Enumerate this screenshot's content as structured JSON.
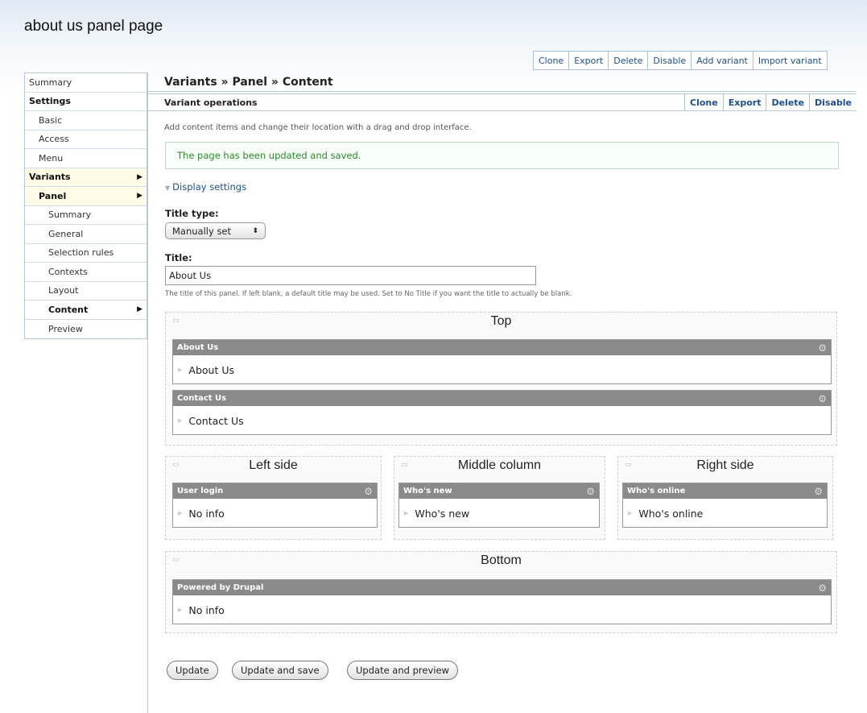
{
  "page": {
    "title": "about us panel page"
  },
  "top_actions": [
    "Clone",
    "Export",
    "Delete",
    "Disable",
    "Add variant",
    "Import variant"
  ],
  "leftnav": [
    {
      "label": "Summary"
    },
    {
      "label": "Settings"
    },
    {
      "label": "Basic"
    },
    {
      "label": "Access"
    },
    {
      "label": "Menu"
    },
    {
      "label": "Variants"
    },
    {
      "label": "Panel"
    },
    {
      "label": "Summary"
    },
    {
      "label": "General"
    },
    {
      "label": "Selection rules"
    },
    {
      "label": "Contexts"
    },
    {
      "label": "Layout"
    },
    {
      "label": "Content"
    },
    {
      "label": "Preview"
    }
  ],
  "main": {
    "breadcrumb": "Variants » Panel » Content",
    "variant_ops": {
      "label": "Variant operations",
      "actions": [
        "Clone",
        "Export",
        "Delete",
        "Disable"
      ]
    },
    "intro": "Add content items and change their location with a drag and drop interface.",
    "status": "The page has been updated and saved.",
    "display_settings": "Display settings",
    "title_type": {
      "label": "Title type:",
      "value": "Manually set"
    },
    "title_field": {
      "label": "Title:",
      "value": "About Us",
      "help": "The title of this panel. If left blank, a default title may be used. Set to No Title if you want the title to actually be blank."
    }
  },
  "regions": {
    "top": {
      "title": "Top",
      "panes": [
        {
          "header": "About Us",
          "body": "About Us"
        },
        {
          "header": "Contact Us",
          "body": "Contact Us"
        }
      ]
    },
    "left": {
      "title": "Left side",
      "pane": {
        "header": "User login",
        "body": "No info"
      }
    },
    "middle": {
      "title": "Middle column",
      "pane": {
        "header": "Who's new",
        "body": "Who's new"
      }
    },
    "right": {
      "title": "Right side",
      "pane": {
        "header": "Who's online",
        "body": "Who's online"
      }
    },
    "bottom": {
      "title": "Bottom",
      "pane": {
        "header": "Powered by Drupal",
        "body": "No info"
      }
    }
  },
  "buttons": {
    "update": "Update",
    "update_save": "Update and save",
    "update_preview": "Update and preview"
  },
  "icons": {
    "gear": "gear-icon",
    "grip": "drag-handle-icon",
    "arrow": "chevron-right-icon",
    "select_arrows": "select-arrows-icon"
  },
  "colors": {
    "link": "#1f4f86",
    "status_text": "#2b8a2b",
    "pane_bar": "#8a8a8a"
  }
}
